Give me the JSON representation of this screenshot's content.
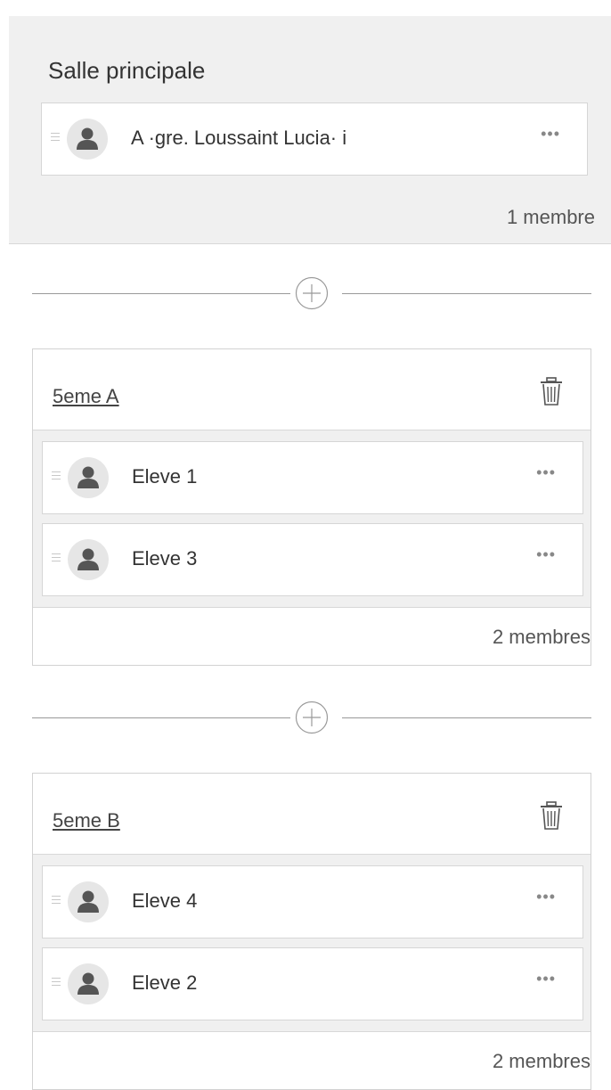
{
  "main_room": {
    "title": "Salle principale",
    "members": [
      {
        "name": "A ·gre. Loussaint Lucia· i"
      }
    ],
    "count": "1 membre"
  },
  "groups": [
    {
      "name": "5eme A",
      "members": [
        {
          "name": "Eleve 1"
        },
        {
          "name": "Eleve 3"
        }
      ],
      "count": "2 membres"
    },
    {
      "name": "5eme B",
      "members": [
        {
          "name": "Eleve 4"
        },
        {
          "name": "Eleve 2"
        }
      ],
      "count": "2 membres"
    }
  ],
  "more_label": "•••",
  "icons": {
    "avatar": "person-icon",
    "grip": "drag-handle-icon",
    "more": "more-options-icon",
    "add": "add-circle-icon",
    "delete": "trash-icon"
  },
  "colors": {
    "panel_bg": "#f0f0f0",
    "border": "#d6d6d6",
    "avatar_bg": "#e6e6e6",
    "avatar_fg": "#555555"
  }
}
